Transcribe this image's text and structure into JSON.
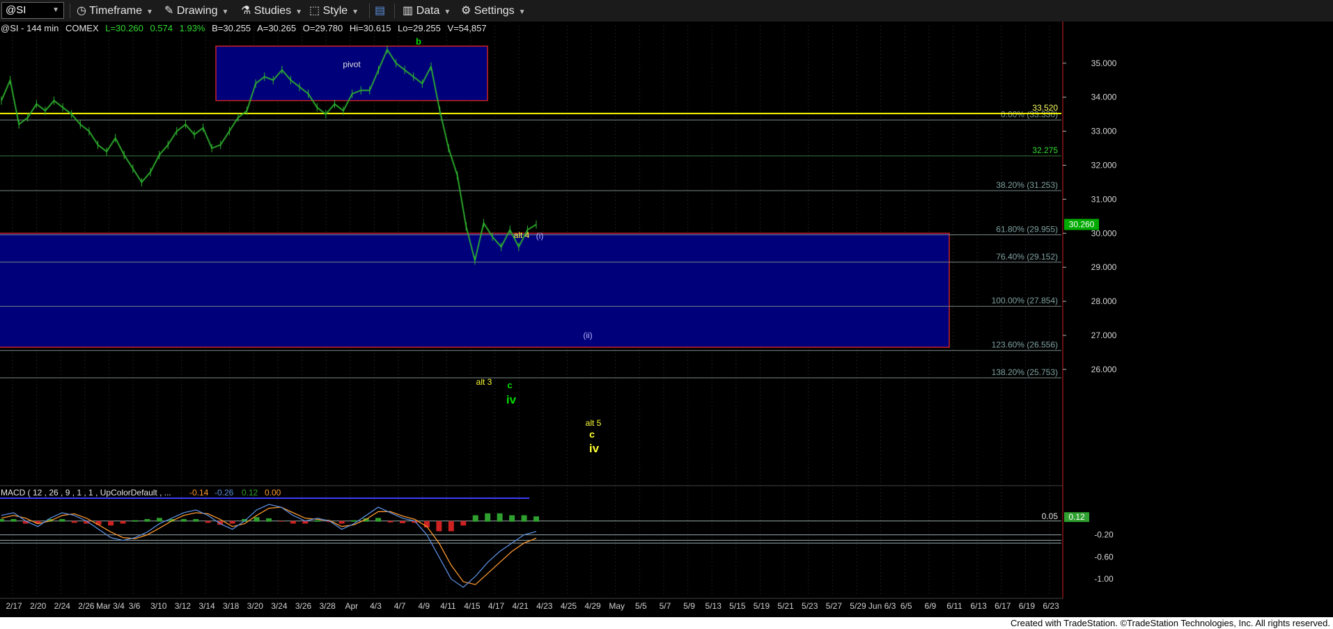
{
  "toolbar": {
    "symbol": "@SI",
    "timeframe_label": "Timeframe",
    "drawing_label": "Drawing",
    "studies_label": "Studies",
    "style_label": "Style",
    "data_label": "Data",
    "settings_label": "Settings"
  },
  "header": {
    "symbol": "@SI",
    "interval": "144 min",
    "exchange": "COMEX",
    "last": "L=30.260",
    "change": "0.574",
    "change_pct": "1.93%",
    "bid": "B=30.255",
    "ask": "A=30.265",
    "open": "O=29.780",
    "high": "Hi=30.615",
    "low": "Lo=29.255",
    "volume": "V=54,857"
  },
  "colors": {
    "price_bar": "#2fb52f",
    "box_fill": "#00007a",
    "box_border": "#cc2222",
    "fib_line": "#7a8a8a",
    "yellow_line": "#ffff00",
    "green_label": "#00dd00",
    "yellow_label": "#ffff33",
    "macd_line": "#5b8fe0",
    "signal_line": "#ff9a2e",
    "hist_pos": "#2fa02f",
    "hist_neg": "#cc2222",
    "last_price_tag": "#00aa00"
  },
  "chart_data": {
    "type": "line",
    "title": "@SI - 144 min COMEX",
    "xlabel": "",
    "ylabel": "",
    "ylim": [
      25.2,
      36.1
    ],
    "x_ticks": [
      "2/17",
      "2/20",
      "2/24",
      "2/26",
      "Mar 3/4",
      "3/6",
      "3/10",
      "3/12",
      "3/14",
      "3/18",
      "3/20",
      "3/24",
      "3/26",
      "3/28",
      "Apr",
      "4/3",
      "4/7",
      "4/9",
      "4/11",
      "4/15",
      "4/17",
      "4/21",
      "4/23",
      "4/25",
      "4/29",
      "May",
      "5/5",
      "5/7",
      "5/9",
      "5/13",
      "5/15",
      "5/19",
      "5/21",
      "5/23",
      "5/27",
      "5/29",
      "Jun 6/3",
      "6/5",
      "6/9",
      "6/11",
      "6/13",
      "6/17",
      "6/19",
      "6/23"
    ],
    "y_ticks": [
      "35.000",
      "34.000",
      "33.000",
      "32.000",
      "31.000",
      "30.000",
      "29.000",
      "28.000",
      "27.000",
      "26.000"
    ],
    "series": [
      {
        "values": [
          33.9,
          34.5,
          33.2,
          33.4,
          33.8,
          33.6,
          33.9,
          33.7,
          33.5,
          33.2,
          33.0,
          32.6,
          32.4,
          32.8,
          32.3,
          31.9,
          31.5,
          31.8,
          32.3,
          32.6,
          33.0,
          33.2,
          32.9,
          33.1,
          32.5,
          32.6,
          33.0,
          33.4,
          33.6,
          34.4,
          34.6,
          34.5,
          34.8,
          34.5,
          34.3,
          34.1,
          33.7,
          33.5,
          33.8,
          33.6,
          34.1,
          34.2,
          34.2,
          34.8,
          35.4,
          35.0,
          34.8,
          34.6,
          34.4,
          34.9,
          33.6,
          32.5,
          31.7,
          30.2,
          29.2,
          30.3,
          29.9,
          29.6,
          30.1,
          29.6,
          30.1,
          30.26
        ]
      }
    ],
    "fib_levels": [
      {
        "label": "0.00% (33.330)",
        "value": 33.33
      },
      {
        "label": "32.275",
        "value": 32.275
      },
      {
        "label": "38.20% (31.253)",
        "value": 31.253
      },
      {
        "label": "61.80% (29.955)",
        "value": 29.955
      },
      {
        "label": "76.40% (29.152)",
        "value": 29.152
      },
      {
        "label": "100.00% (27.854)",
        "value": 27.854
      },
      {
        "label": "123.60% (26.556)",
        "value": 26.556
      },
      {
        "label": "138.20% (25.753)",
        "value": 25.753
      }
    ],
    "yellow_level": {
      "label": "33.520",
      "value": 33.52
    },
    "last_price_tag": "30.260",
    "pivot_box": {
      "label": "pivot",
      "low": 33.9,
      "high": 35.5
    },
    "support_box": {
      "low": 26.65,
      "high": 30.0
    },
    "wave_labels": [
      "b",
      "alt 4",
      "(i)",
      "(ii)",
      "alt 3",
      "c",
      "iv",
      "alt 5",
      "c",
      "iv"
    ],
    "macd": {
      "label": "MACD ( 12 , 26 , 9 , 1 , 1 , UpColorDefault , ...",
      "values_display": [
        "-0.14",
        "-0.26",
        "0.12",
        "0.00"
      ],
      "y_ticks": [
        "-0.20",
        "-0.60",
        "-1.00"
      ],
      "level_labels": [
        "0.05",
        "0.12"
      ],
      "macd_line": [
        0.15,
        0.2,
        0.05,
        -0.05,
        0.1,
        0.2,
        0.15,
        0.05,
        -0.1,
        -0.25,
        -0.3,
        -0.25,
        -0.15,
        0.0,
        0.1,
        0.2,
        0.25,
        0.15,
        0.0,
        -0.1,
        0.05,
        0.25,
        0.35,
        0.3,
        0.15,
        0.05,
        0.1,
        0.05,
        -0.1,
        0.0,
        0.15,
        0.3,
        0.2,
        0.1,
        0.05,
        -0.2,
        -0.6,
        -1.0,
        -1.15,
        -0.95,
        -0.7,
        -0.5,
        -0.35,
        -0.2,
        -0.14
      ],
      "signal_line": [
        0.1,
        0.15,
        0.1,
        0.0,
        0.05,
        0.15,
        0.18,
        0.1,
        -0.02,
        -0.15,
        -0.25,
        -0.27,
        -0.2,
        -0.08,
        0.05,
        0.15,
        0.2,
        0.18,
        0.08,
        -0.05,
        0.0,
        0.15,
        0.28,
        0.3,
        0.2,
        0.1,
        0.08,
        0.06,
        -0.05,
        -0.02,
        0.08,
        0.22,
        0.22,
        0.14,
        0.08,
        -0.05,
        -0.35,
        -0.75,
        -1.05,
        -1.1,
        -0.9,
        -0.7,
        -0.5,
        -0.35,
        -0.26
      ]
    }
  },
  "footer": {
    "text": "Created with TradeStation. ©TradeStation Technologies, Inc. All rights reserved."
  }
}
